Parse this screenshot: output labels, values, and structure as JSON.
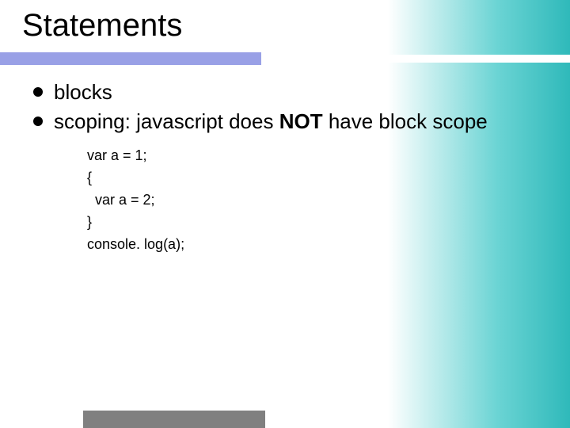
{
  "title": "Statements",
  "bullets": {
    "b1": "blocks",
    "b2_pre": "scoping: javascript does ",
    "b2_not": "NOT",
    "b2_post": " have block scope"
  },
  "code": {
    "l1": "var a = 1;",
    "l2": "{",
    "l3": "  var a = 2;",
    "l4": "}",
    "l5": "console. log(a);"
  }
}
